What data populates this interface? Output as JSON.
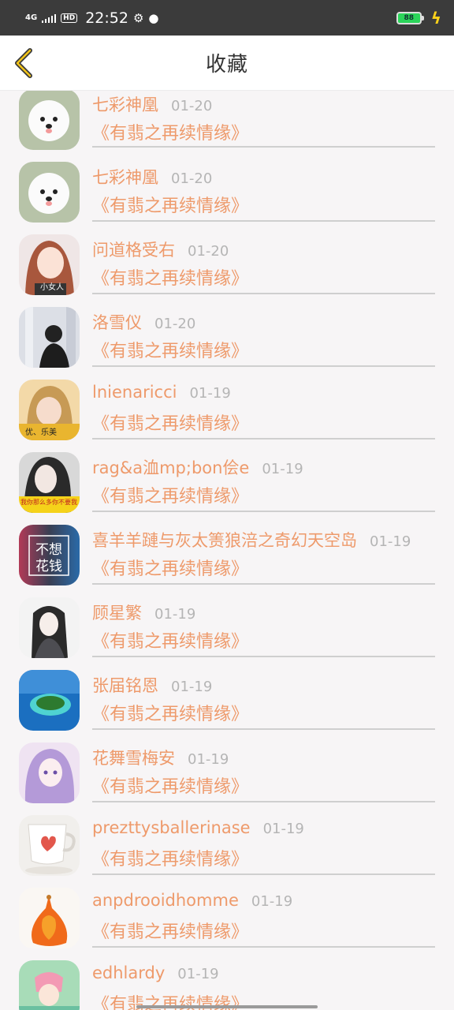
{
  "status_bar": {
    "network": "4G",
    "hd": "HD",
    "time": "22:52",
    "battery": "88"
  },
  "header": {
    "title": "收藏"
  },
  "items": [
    {
      "name": "七彩神凰",
      "date": "01-20",
      "work": "《有翡之再续情缘》"
    },
    {
      "name": "七彩神凰",
      "date": "01-20",
      "work": "《有翡之再续情缘》"
    },
    {
      "name": "问道格受右",
      "date": "01-20",
      "work": "《有翡之再续情缘》"
    },
    {
      "name": "洛雪仪",
      "date": "01-20",
      "work": "《有翡之再续情缘》"
    },
    {
      "name": "lnienaricci",
      "date": "01-19",
      "work": "《有翡之再续情缘》"
    },
    {
      "name": "rag&a洫mp;bon侩e",
      "date": "01-19",
      "work": "《有翡之再续情缘》"
    },
    {
      "name": "喜羊羊蹥与灰太箦狼涪之奇幻天空岛",
      "date": "01-19",
      "work": "《有翡之再续情缘》"
    },
    {
      "name": "顾星繁",
      "date": "01-19",
      "work": "《有翡之再续情缘》"
    },
    {
      "name": "张届铭恩",
      "date": "01-19",
      "work": "《有翡之再续情缘》"
    },
    {
      "name": "花舞雪梅安",
      "date": "01-19",
      "work": "《有翡之再续情缘》"
    },
    {
      "name": "prezttysballerinase",
      "date": "01-19",
      "work": "《有翡之再续情缘》"
    },
    {
      "name": "anpdrooidhomme",
      "date": "01-19",
      "work": "《有翡之再续情缘》"
    },
    {
      "name": "edhlardy",
      "date": "01-19",
      "work": "《有翡之再续情缘》"
    }
  ],
  "avatar_text": {
    "a2": "小女人",
    "a4": "优、乐美",
    "a5": "我你那么多你不要我",
    "a6_top": "不想",
    "a6_bottom": "花钱"
  },
  "colors": {
    "accent": "#ee9a6b",
    "date": "#b5b5b5",
    "status_bar": "#3b3b3b",
    "background": "#f7f5f6"
  }
}
